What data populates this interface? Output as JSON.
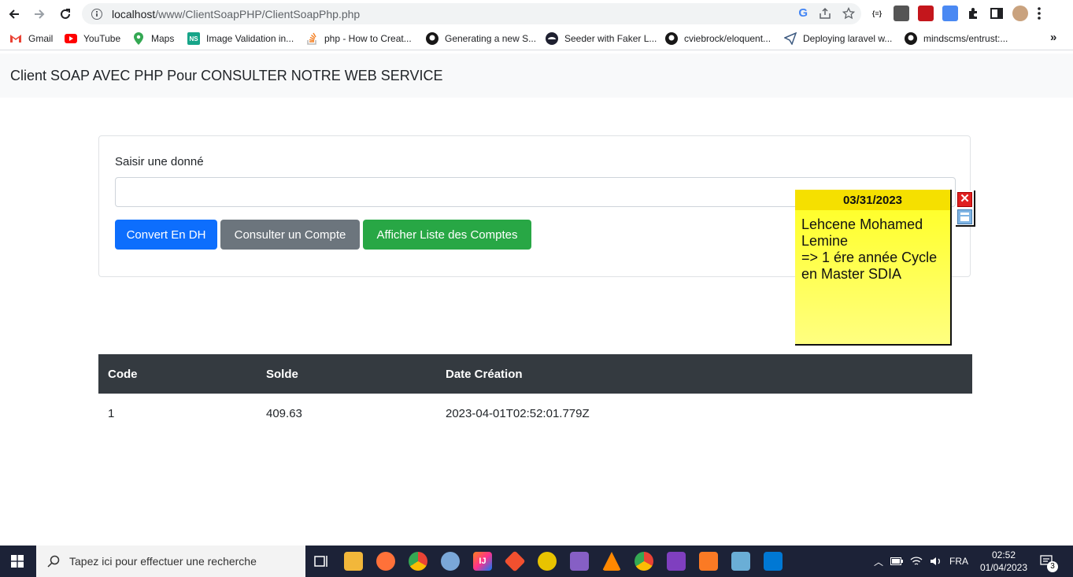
{
  "browser": {
    "url_host": "localhost",
    "url_path": "/www/ClientSoapPHP/ClientSoapPhp.php",
    "extensions": [
      "{≡}",
      "",
      "",
      "",
      "",
      "",
      ""
    ]
  },
  "bookmarks": [
    {
      "label": "Gmail"
    },
    {
      "label": "YouTube"
    },
    {
      "label": "Maps"
    },
    {
      "label": "Image Validation in..."
    },
    {
      "label": "php - How to Creat..."
    },
    {
      "label": "Generating a new S..."
    },
    {
      "label": "Seeder with Faker L..."
    },
    {
      "label": "cviebrock/eloquent..."
    },
    {
      "label": "Deploying laravel w..."
    },
    {
      "label": "mindscms/entrust:..."
    }
  ],
  "page": {
    "title": "Client SOAP AVEC PHP Pour CONSULTER NOTRE WEB SERVICE",
    "form": {
      "label": "Saisir une donné",
      "input_value": "",
      "buttons": {
        "convert": "Convert En DH",
        "consult": "Consulter un Compte",
        "list": "Afficher Liste des Comptes"
      }
    },
    "table": {
      "headers": [
        "Code",
        "Solde",
        "Date Création"
      ],
      "rows": [
        [
          "1",
          "409.63",
          "2023-04-01T02:52:01.779Z"
        ]
      ]
    }
  },
  "sticky_note": {
    "date": "03/31/2023",
    "lines": [
      "Lehcene Mohamed",
      "Lemine",
      "=> 1 ére année Cycle",
      "en Master SDIA"
    ],
    "close_symbol": "✕"
  },
  "taskbar": {
    "search_placeholder": "Tapez ici pour effectuer une recherche",
    "language": "FRA",
    "time": "02:52",
    "date": "01/04/2023",
    "notification_count": "3"
  }
}
